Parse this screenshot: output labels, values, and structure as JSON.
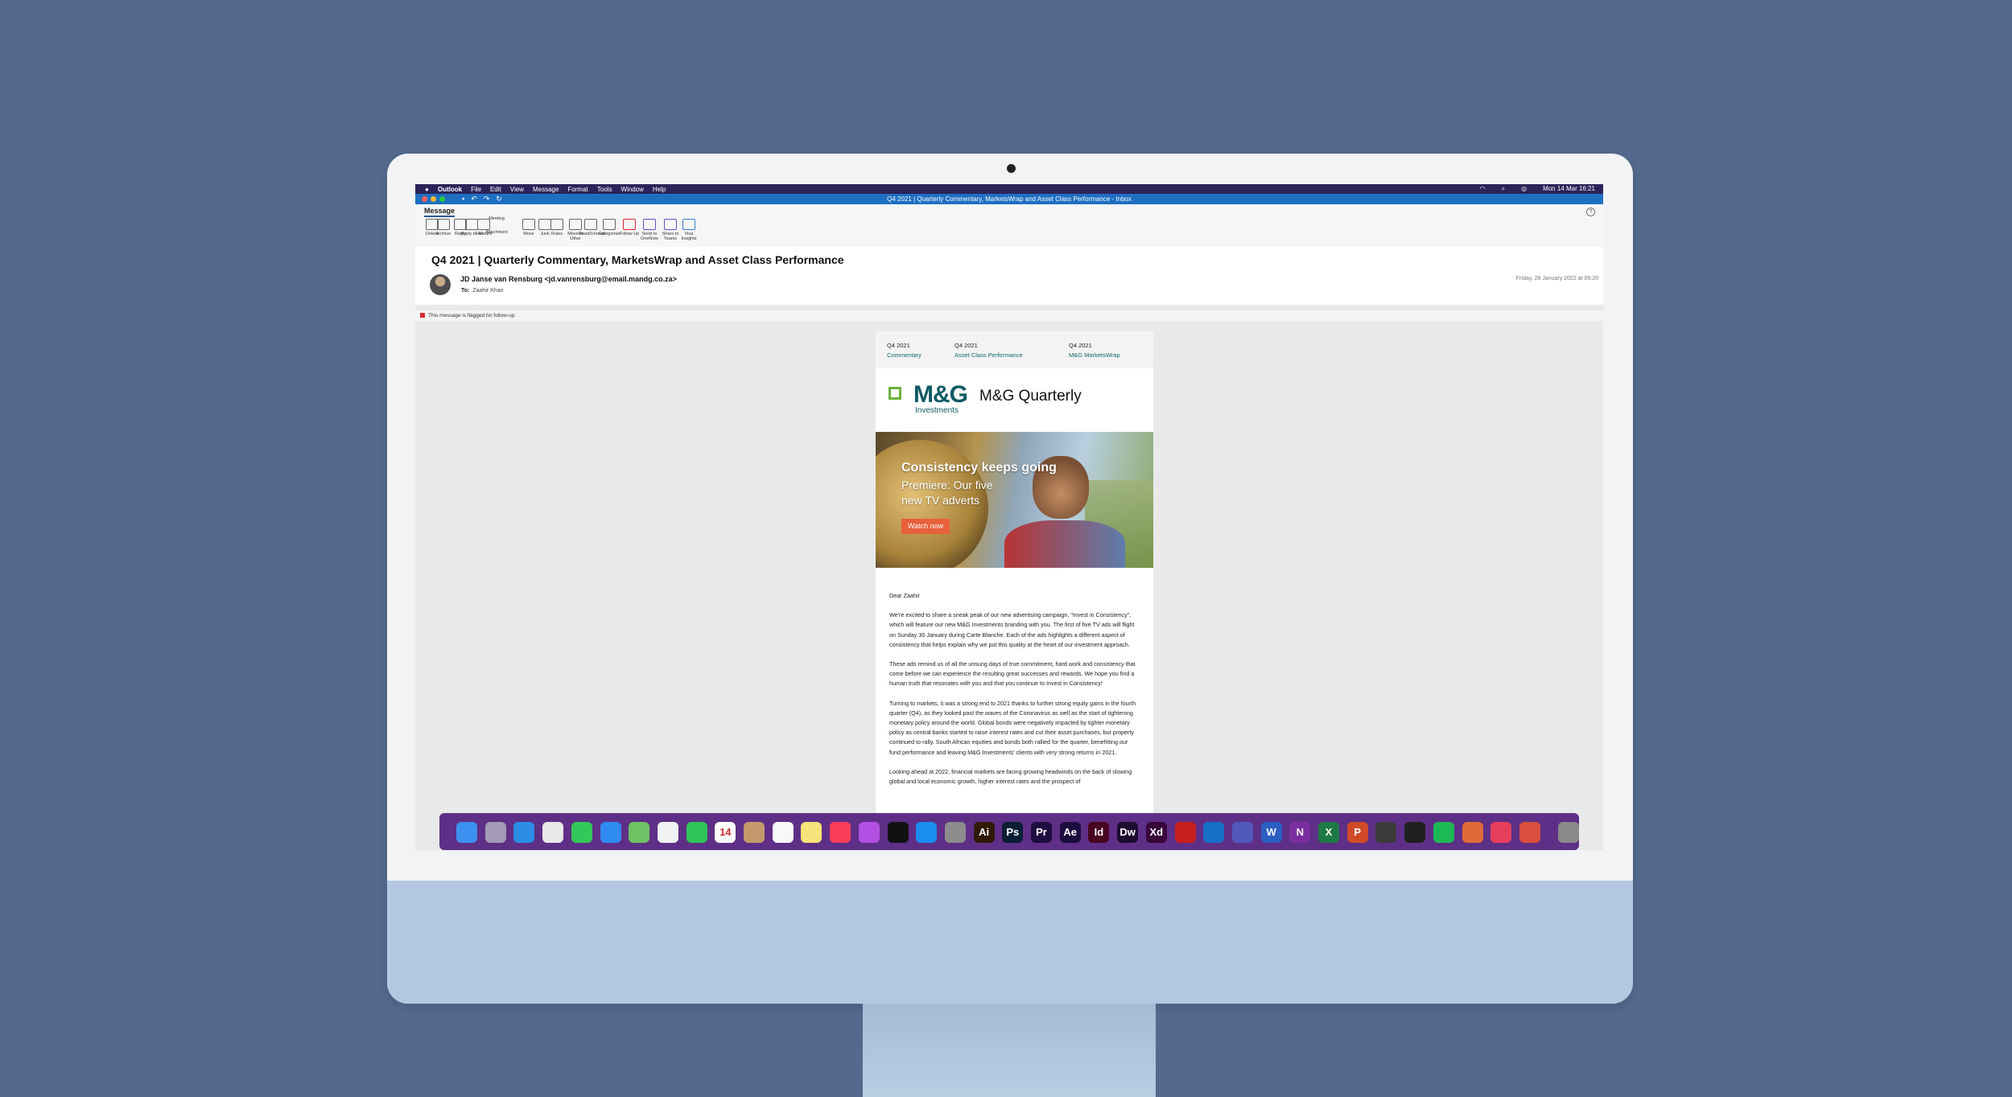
{
  "menubar": {
    "apple": "",
    "app": "Outlook",
    "items": [
      "File",
      "Edit",
      "View",
      "Message",
      "Format",
      "Tools",
      "Window",
      "Help"
    ],
    "clock": "Mon 14 Mar  16:21"
  },
  "window": {
    "title": "Q4 2021 | Quarterly Commentary, MarketsWrap and Asset Class Performance - Inbox"
  },
  "ribbon": {
    "tab": "Message",
    "buttons": [
      {
        "label": "Delete",
        "icon": "trash-icon"
      },
      {
        "label": "Archive",
        "icon": "archive-icon"
      },
      {
        "label": "Reply",
        "icon": "reply-icon"
      },
      {
        "label": "Reply to All",
        "icon": "reply-all-icon"
      },
      {
        "label": "Forward",
        "icon": "forward-icon"
      },
      {
        "label": "Meeting",
        "icon": "meeting-icon"
      },
      {
        "label": "Attachment",
        "icon": "attachment-icon"
      },
      {
        "label": "Move",
        "icon": "move-icon"
      },
      {
        "label": "Junk",
        "icon": "junk-icon"
      },
      {
        "label": "Rules",
        "icon": "rules-icon"
      },
      {
        "label": "Move to Other",
        "icon": "move-other-icon"
      },
      {
        "label": "Read/Unread",
        "icon": "read-unread-icon"
      },
      {
        "label": "Categorise",
        "icon": "categorise-icon"
      },
      {
        "label": "Follow Up",
        "icon": "flag-icon"
      },
      {
        "label": "Send to OneNote",
        "icon": "onenote-icon"
      },
      {
        "label": "Share to Teams",
        "icon": "teams-icon"
      },
      {
        "label": "Viva Insights",
        "icon": "viva-icon"
      }
    ]
  },
  "message": {
    "subject": "Q4 2021 | Quarterly Commentary, MarketsWrap and Asset Class Performance",
    "from": "JD Janse van Rensburg <jd.vanrensburg@email.mandg.co.za>",
    "to_label": "To:",
    "to": "Zaahir Khan",
    "date": "Friday, 28 January 2022 at 09:20",
    "flag_notice": "This message is flagged for follow-up."
  },
  "email": {
    "nav": [
      {
        "top": "Q4 2021",
        "link": "Commentary"
      },
      {
        "top": "Q4 2021",
        "link": "Asset Class Performance"
      },
      {
        "top": "Q4 2021",
        "link": "M&G MarketsWrap"
      }
    ],
    "logo_main": "M&G",
    "logo_sub": "Investments",
    "header_title": "M&G Quarterly",
    "hero_title": "Consistency keeps going",
    "hero_sub": "Premiere: Our five new TV adverts",
    "cta": "Watch now",
    "greeting": "Dear Zaahir",
    "paragraphs": [
      "We're excited to share a sneak peak of our new advertising campaign, “Invest in Consistency”, which will feature our new M&G Investments branding with you. The first of five TV ads will flight on Sunday 30 January during Carte Blanche. Each of the ads highlights a different aspect of consistency that helps explain why we put this quality at the heart of our investment approach.",
      "These ads remind us of all the unsung days of true commitment, hard work and consistency that come before we can experience the resulting great successes and rewards. We hope you find a human truth that resonates with you and that you continue to Invest in Consistency!",
      "Turning to markets, it was a strong end to 2021 thanks to further strong equity gains in the fourth quarter (Q4), as they looked past the waves of the Coronavirus as well as the start of tightening monetary policy around the world. Global bonds were negatively impacted by tighter monetary policy as central banks started to raise interest rates and cut their asset purchases, but property continued to rally. South African equities and bonds both rallied for the quarter, benefitting our fund performance and leaving M&G Investments' clients with very strong returns in 2021.",
      "Looking ahead at 2022, financial markets are facing growing headwinds on the back of slowing global and local economic growth, higher interest rates and the prospect of"
    ]
  },
  "dock": {
    "apps": [
      {
        "name": "finder-icon",
        "label": "",
        "color": "#3d8ff0"
      },
      {
        "name": "launchpad-icon",
        "label": "",
        "color": "#a39ab5"
      },
      {
        "name": "safari-icon",
        "label": "",
        "color": "#2b8de6"
      },
      {
        "name": "chrome-icon",
        "label": "",
        "color": "#e8e8e8"
      },
      {
        "name": "messages-icon",
        "label": "",
        "color": "#34c759"
      },
      {
        "name": "mail-icon",
        "label": "",
        "color": "#2f8bf0"
      },
      {
        "name": "maps-icon",
        "label": "",
        "color": "#6dc264"
      },
      {
        "name": "photos-icon",
        "label": "",
        "color": "#f2f2f2"
      },
      {
        "name": "facetime-icon",
        "label": "",
        "color": "#30c55a"
      },
      {
        "name": "calendar-icon",
        "label": "14",
        "color": "#ffffff"
      },
      {
        "name": "contacts-icon",
        "label": "",
        "color": "#c49a6c"
      },
      {
        "name": "reminders-icon",
        "label": "",
        "color": "#f8f8f8"
      },
      {
        "name": "notes-icon",
        "label": "",
        "color": "#f8e27a"
      },
      {
        "name": "music-icon",
        "label": "",
        "color": "#fc3d5a"
      },
      {
        "name": "podcasts-icon",
        "label": "",
        "color": "#b150e2"
      },
      {
        "name": "tv-icon",
        "label": "",
        "color": "#111111"
      },
      {
        "name": "app-store-icon",
        "label": "",
        "color": "#1c8ef0"
      },
      {
        "name": "system-preferences-icon",
        "label": "",
        "color": "#8c8c8c"
      },
      {
        "name": "illustrator-icon",
        "label": "Ai",
        "color": "#2e1a05"
      },
      {
        "name": "photoshop-icon",
        "label": "Ps",
        "color": "#0a1e35"
      },
      {
        "name": "premiere-icon",
        "label": "Pr",
        "color": "#1f0c40"
      },
      {
        "name": "after-effects-icon",
        "label": "Ae",
        "color": "#1c0c40"
      },
      {
        "name": "indesign-icon",
        "label": "Id",
        "color": "#47051f"
      },
      {
        "name": "dreamweaver-icon",
        "label": "Dw",
        "color": "#1d0b30"
      },
      {
        "name": "xd-icon",
        "label": "Xd",
        "color": "#37053b"
      },
      {
        "name": "acrobat-icon",
        "label": "",
        "color": "#c81e1e"
      },
      {
        "name": "outlook-icon",
        "label": "",
        "color": "#1770c8"
      },
      {
        "name": "teams-icon",
        "label": "",
        "color": "#5158bb"
      },
      {
        "name": "word-icon",
        "label": "W",
        "color": "#2b5fc2"
      },
      {
        "name": "onenote-icon",
        "label": "N",
        "color": "#7a2ea0"
      },
      {
        "name": "excel-icon",
        "label": "X",
        "color": "#1d7a45"
      },
      {
        "name": "powerpoint-icon",
        "label": "P",
        "color": "#d04a28"
      },
      {
        "name": "sublime-icon",
        "label": "",
        "color": "#3b3b3b"
      },
      {
        "name": "resolve-icon",
        "label": "",
        "color": "#202020"
      },
      {
        "name": "spotify-icon",
        "label": "",
        "color": "#1db954"
      },
      {
        "name": "cocktail-icon",
        "label": "",
        "color": "#e06a3a"
      },
      {
        "name": "creative-cloud-icon",
        "label": "",
        "color": "#e63e5c"
      },
      {
        "name": "compass-icon",
        "label": "",
        "color": "#d94f3d"
      },
      {
        "name": "trash-icon",
        "label": "",
        "color": "#8a8a8a"
      }
    ]
  }
}
